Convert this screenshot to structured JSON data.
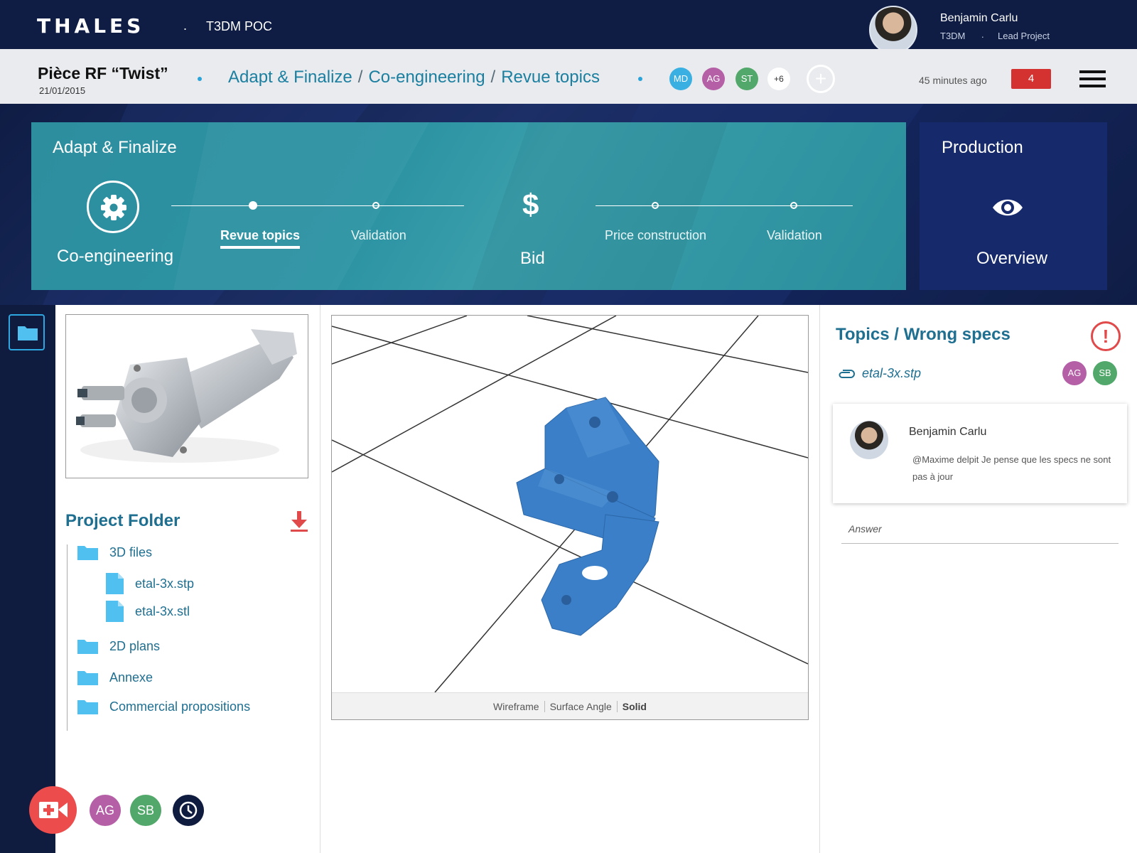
{
  "topbar": {
    "brand": "THALES",
    "separator": ".",
    "app_name": "T3DM POC",
    "user": {
      "name": "Benjamin Carlu",
      "org": "T3DM",
      "sep": ".",
      "role": "Lead Project"
    }
  },
  "crumbbar": {
    "part_title": "Pièce RF “Twist”",
    "part_date": "21/01/2015",
    "breadcrumb": [
      "Adapt & Finalize",
      "Co-engineering",
      "Revue topics"
    ],
    "breadcrumb_sep": "/",
    "participants": [
      {
        "initials": "MD",
        "color": "#3ab0e2"
      },
      {
        "initials": "AG",
        "color": "#b45fa6"
      },
      {
        "initials": "ST",
        "color": "#52a86a"
      },
      {
        "initials": "+6",
        "color": "#ffffff"
      }
    ],
    "add_symbol": "+",
    "last_update": "45 minutes ago",
    "notification_count": "4"
  },
  "stages": {
    "current_stage": "Adapt & Finalize",
    "coengineering_label": "Co-engineering",
    "steps": [
      "Revue topics",
      "Validation"
    ],
    "bid_symbol": "$",
    "bid_label": "Bid",
    "bid_steps": [
      "Price construction",
      "Validation"
    ],
    "next_stage": "Production",
    "overview_label": "Overview"
  },
  "left": {
    "project_folder_title": "Project Folder",
    "tree": [
      {
        "type": "folder",
        "label": "3D files"
      },
      {
        "type": "file",
        "label": "etal-3x.stp"
      },
      {
        "type": "file",
        "label": "etal-3x.stl"
      },
      {
        "type": "folder",
        "label": "2D plans"
      },
      {
        "type": "folder",
        "label": "Annexe"
      },
      {
        "type": "folder",
        "label": "Commercial propositions"
      }
    ],
    "bottom_avatars": [
      {
        "initials": "AG",
        "color": "#b45fa6"
      },
      {
        "initials": "SB",
        "color": "#52a86a"
      }
    ]
  },
  "viewer": {
    "modes": [
      "Wireframe",
      "Surface Angle",
      "Solid"
    ],
    "active_mode": "Solid",
    "model_color": "#3a7fc8"
  },
  "topic": {
    "title": "Topics / Wrong specs",
    "alert_symbol": "!",
    "attachment": "etal-3x.stp",
    "avatars": [
      {
        "initials": "AG",
        "color": "#b45fa6"
      },
      {
        "initials": "SB",
        "color": "#52a86a"
      }
    ],
    "comment": {
      "author": "Benjamin Carlu",
      "text": "@Maxime delpit Je pense que les specs ne sont pas à jour"
    },
    "answer_placeholder": "Answer"
  },
  "colors": {
    "navy": "#0f1d45",
    "teal_panel": "#2d8e9e",
    "production_panel": "#15296b",
    "accent_blue": "#1f6f91",
    "alert_red": "#e14a4a",
    "notif_red": "#d43131",
    "folder_blue": "#4fc0ef"
  }
}
